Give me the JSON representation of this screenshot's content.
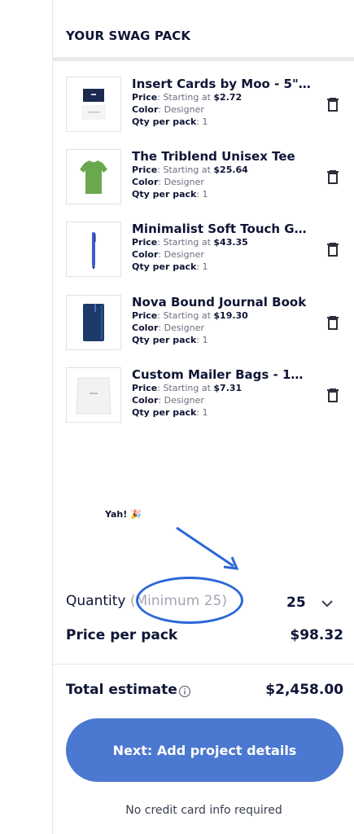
{
  "swag_pack": {
    "header": "YOUR SWAG PACK",
    "items": [
      {
        "title": "Insert Cards by Moo - 5\" ...",
        "price_label": "Price",
        "price_prefix": ": Starting at ",
        "price": "$2.72",
        "color_label": "Color",
        "color_value": ": Designer",
        "qty_label": "Qty per pack",
        "qty_value": ": 1",
        "thumb_icon": "insert-card-thumbnail"
      },
      {
        "title": "The Triblend Unisex Tee",
        "price_label": "Price",
        "price_prefix": ": Starting at ",
        "price": "$25.64",
        "color_label": "Color",
        "color_value": ": Designer",
        "qty_label": "Qty per pack",
        "qty_value": ": 1",
        "thumb_icon": "tshirt-thumbnail"
      },
      {
        "title": "Minimalist Soft Touch Ge...",
        "price_label": "Price",
        "price_prefix": ": Starting at ",
        "price": "$43.35",
        "color_label": "Color",
        "color_value": ": Designer",
        "qty_label": "Qty per pack",
        "qty_value": ": 1",
        "thumb_icon": "pen-thumbnail"
      },
      {
        "title": "Nova Bound Journal Book",
        "price_label": "Price",
        "price_prefix": ": Starting at ",
        "price": "$19.30",
        "color_label": "Color",
        "color_value": ": Designer",
        "qty_label": "Qty per pack",
        "qty_value": ": 1",
        "thumb_icon": "journal-thumbnail"
      },
      {
        "title": "Custom Mailer Bags - 10...",
        "price_label": "Price",
        "price_prefix": ": Starting at ",
        "price": "$7.31",
        "color_label": "Color",
        "color_value": ": Designer",
        "qty_label": "Qty per pack",
        "qty_value": ": 1",
        "thumb_icon": "mailer-bag-thumbnail"
      }
    ]
  },
  "annotation": {
    "text": "Yah! 🎉"
  },
  "quantity": {
    "label": "Quantity ",
    "minimum": "(Minimum 25)",
    "value": "25"
  },
  "price_per_pack": {
    "label": "Price per pack",
    "value": "$98.32"
  },
  "total": {
    "label": "Total estimate",
    "value": "$2,458.00"
  },
  "next_button": {
    "label": "Next: Add project details"
  },
  "footnote": "No credit card info required",
  "colors": {
    "accent": "#4b78d0",
    "annotation": "#2c67d8"
  }
}
